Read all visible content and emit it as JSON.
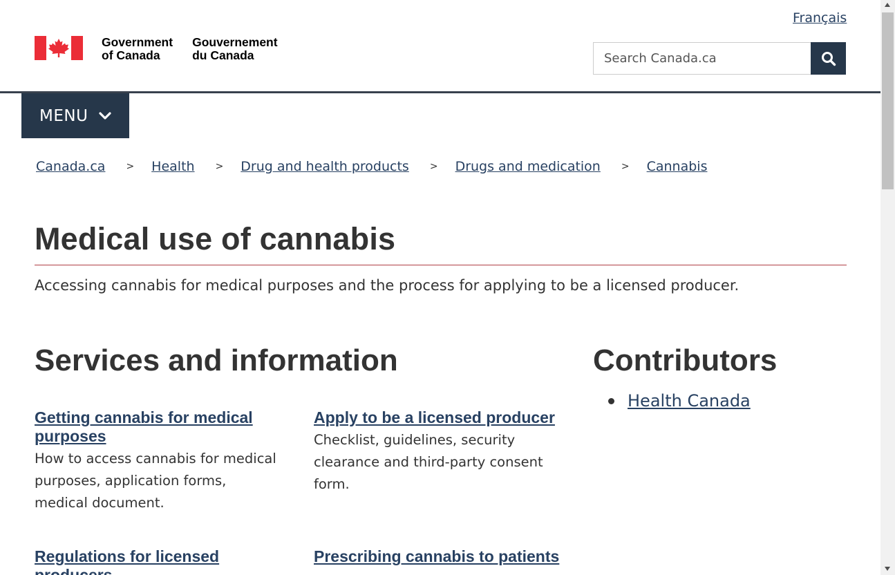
{
  "header": {
    "language_link": "Français",
    "gov_name_en": [
      "Government",
      "of Canada"
    ],
    "gov_name_fr": [
      "Gouvernement",
      "du Canada"
    ],
    "search_placeholder": "Search Canada.ca",
    "menu_label": "MENU"
  },
  "icons": {
    "flag": "canada-flag-icon",
    "search": "magnifier-icon",
    "menu": "chevron-down-icon"
  },
  "breadcrumb": [
    "Canada.ca",
    "Health",
    "Drug and health products",
    "Drugs and medication",
    "Cannabis"
  ],
  "breadcrumb_separator": ">",
  "page": {
    "title": "Medical use of cannabis",
    "intro": "Accessing cannabis for medical purposes and the process for applying to be a licensed producer."
  },
  "services": {
    "title": "Services and information",
    "items": [
      {
        "link": "Getting cannabis for medical purposes",
        "desc": "How to access cannabis for medical purposes, application forms, medical document."
      },
      {
        "link": "Apply to be a licensed producer",
        "desc": "Checklist, guidelines, security clearance and third-party consent form."
      },
      {
        "link": "Regulations for licensed producers",
        "desc": ""
      },
      {
        "link": "Prescribing cannabis to patients",
        "desc": ""
      }
    ]
  },
  "contributors": {
    "title": "Contributors",
    "items": [
      "Health Canada"
    ]
  },
  "colors": {
    "link": "#284162",
    "dark_blue": "#26374a",
    "title_rule": "#af3c43",
    "flag_red": "#eb2d37"
  }
}
